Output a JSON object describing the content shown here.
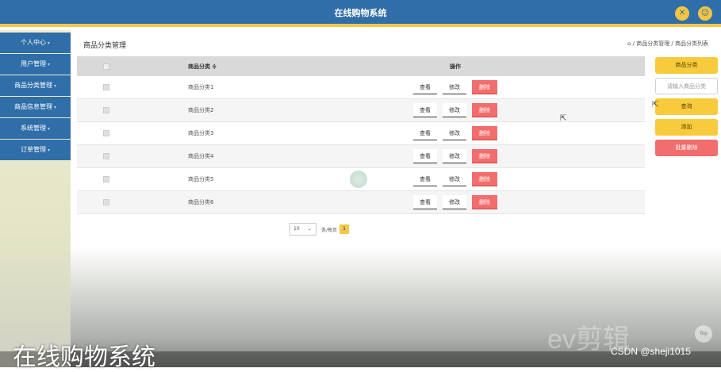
{
  "header": {
    "title": "在线购物系统",
    "icon_left": "expand-icon",
    "icon_right": "user-icon"
  },
  "sidebar": {
    "items": [
      {
        "label": "个人中心"
      },
      {
        "label": "用户管理"
      },
      {
        "label": "商品分类管理"
      },
      {
        "label": "商品信息管理"
      },
      {
        "label": "系统管理"
      },
      {
        "label": "订单管理"
      }
    ]
  },
  "page": {
    "heading": "商品分类管理",
    "breadcrumb": "⌂ / 商品分类管理 / 商品分类列表"
  },
  "table": {
    "headers": {
      "name": "商品分类 ≑",
      "ops": "操作"
    },
    "rows": [
      {
        "name": "商品分类1"
      },
      {
        "name": "商品分类2"
      },
      {
        "name": "商品分类3"
      },
      {
        "name": "商品分类4"
      },
      {
        "name": "商品分类5"
      },
      {
        "name": "商品分类6"
      }
    ],
    "op_labels": {
      "view": "查看",
      "edit": "修改",
      "delete": "删除"
    }
  },
  "pagination": {
    "page_size": "10",
    "per_page_label": "条/每页",
    "current_page": "1"
  },
  "right_panel": {
    "category_label": "商品分类",
    "search_placeholder": "请输入商品分类",
    "query": "查询",
    "add": "添加",
    "batch_delete": "批量删除"
  },
  "overlay": {
    "video_title": "在线购物系统",
    "watermark": "CSDN @sheji1015",
    "ev_logo": "ev剪辑",
    "top_button": "Top"
  },
  "colors": {
    "primary": "#2f6ea8",
    "accent": "#f2c94c",
    "danger": "#f26d6d"
  }
}
